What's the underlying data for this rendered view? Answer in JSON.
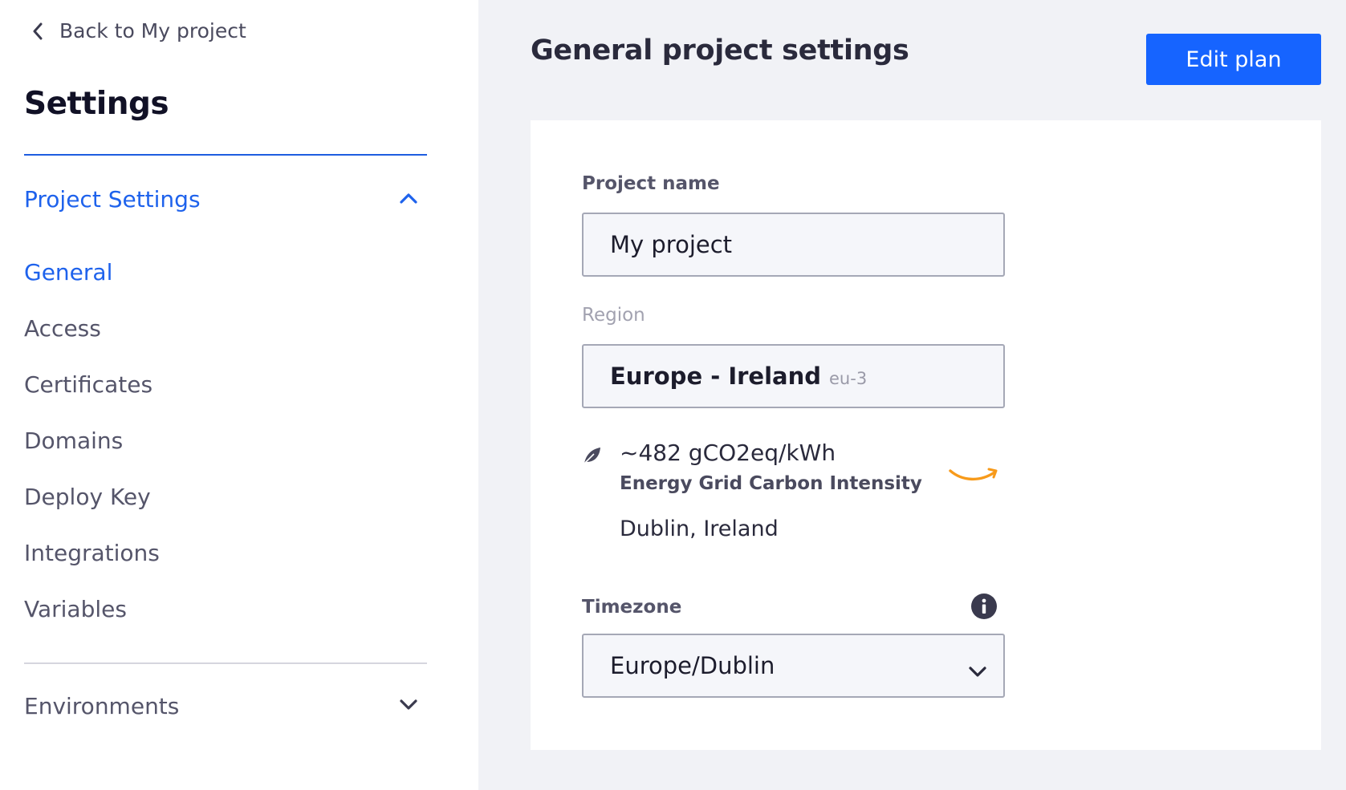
{
  "sidebar": {
    "back_label": "Back to My project",
    "title": "Settings",
    "project_section": {
      "label": "Project Settings",
      "expanded": true,
      "items": [
        {
          "label": "General",
          "active": true
        },
        {
          "label": "Access"
        },
        {
          "label": "Certificates"
        },
        {
          "label": "Domains"
        },
        {
          "label": "Deploy Key"
        },
        {
          "label": "Integrations"
        },
        {
          "label": "Variables"
        }
      ]
    },
    "environments_section": {
      "label": "Environments",
      "expanded": false
    }
  },
  "main": {
    "title": "General project settings",
    "edit_plan_label": "Edit plan",
    "project_name": {
      "label": "Project name",
      "value": "My project"
    },
    "region": {
      "label": "Region",
      "name": "Europe - Ireland",
      "code": "eu-3",
      "carbon_value": "~482 gCO2eq/kWh",
      "carbon_label": "Energy Grid Carbon Intensity",
      "location": "Dublin, Ireland",
      "provider_logo": "amazon-logo"
    },
    "timezone": {
      "label": "Timezone",
      "value": "Europe/Dublin"
    }
  },
  "colors": {
    "accent": "#1664ff",
    "link_active": "#1e62ec",
    "amazon_orange": "#f79a1a"
  }
}
